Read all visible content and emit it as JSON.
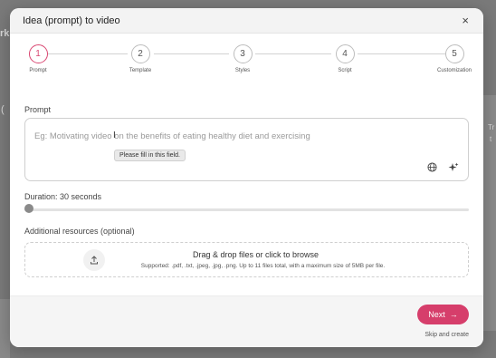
{
  "background": {
    "left_fragment_1": "rk",
    "left_fragment_2": "(",
    "left_fragment_3": "(",
    "right_fragment_1": "Tr",
    "right_fragment_2": "t"
  },
  "modal": {
    "title": "Idea (prompt) to video",
    "close_glyph": "×"
  },
  "stepper": {
    "steps": [
      {
        "number": "1",
        "label": "Prompt"
      },
      {
        "number": "2",
        "label": "Template"
      },
      {
        "number": "3",
        "label": "Styles"
      },
      {
        "number": "4",
        "label": "Script"
      },
      {
        "number": "5",
        "label": "Customization"
      }
    ],
    "active_step": 1
  },
  "prompt": {
    "label": "Prompt",
    "placeholder": "Eg: Motivating video on the benefits of eating healthy diet and exercising",
    "tooltip": "Please fill in this field.",
    "icons": [
      "globe-icon",
      "sparkle-icon"
    ]
  },
  "duration": {
    "label": "Duration: 30 seconds",
    "value_fraction": 0
  },
  "resources": {
    "label": "Additional resources (optional)",
    "title": "Drag & drop files or click to browse",
    "subtitle": "Supported: .pdf, .txt, .jpeg, .jpg, .png. Up to 11 files total, with a maximum size of 5MB per file."
  },
  "footer": {
    "next_label": "Next",
    "next_arrow": "→",
    "skip_label": "Skip and create"
  },
  "colors": {
    "accent": "#d63e6b",
    "overlay": "#6f6f6f"
  }
}
